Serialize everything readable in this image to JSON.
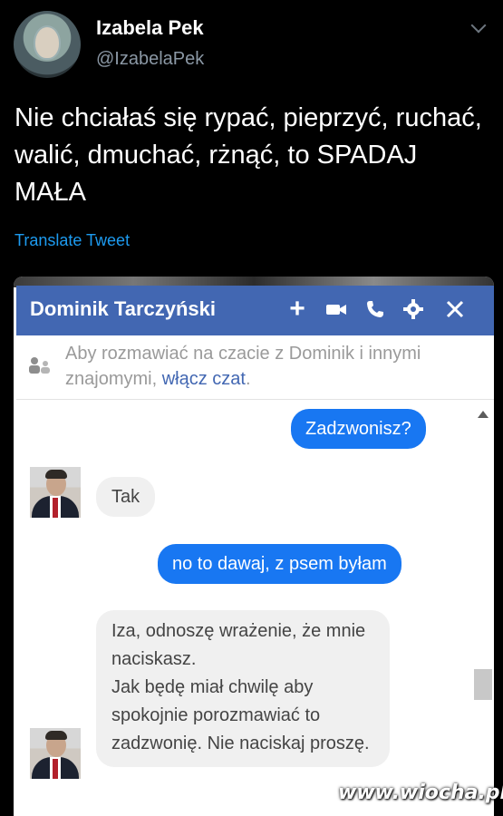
{
  "tweet": {
    "author_name": "Izabela Pek",
    "author_handle": "@IzabelaPek",
    "text": "Nie chciałaś się rypać, pieprzyć, ruchać, walić, dmuchać, rżnąć, to SPADAJ MAŁA",
    "translate_label": "Translate Tweet"
  },
  "chat": {
    "title": "Dominik Tarczyński",
    "header_icons": [
      "plus-icon",
      "video-icon",
      "phone-icon",
      "gear-icon",
      "close-icon"
    ],
    "notice_prefix": "Aby rozmawiać na czacie z Dominik i innymi znajomymi,",
    "notice_link": "włącz czat",
    "notice_suffix": ".",
    "messages": [
      {
        "from": "me",
        "text": "Zadzwonisz?"
      },
      {
        "from": "them",
        "text": "Tak"
      },
      {
        "from": "me",
        "text": "no to dawaj, z psem byłam"
      },
      {
        "from": "them",
        "text": "Iza, odnoszę wrażenie, że mnie naciskasz.\nJak będę miał chwilę aby spokojnie porozmawiać to zadzwonię.  Nie naciskaj proszę."
      }
    ],
    "accent_color": "#4267b2",
    "outgoing_color": "#1877f2"
  },
  "watermark": "www.wiocha.pl"
}
